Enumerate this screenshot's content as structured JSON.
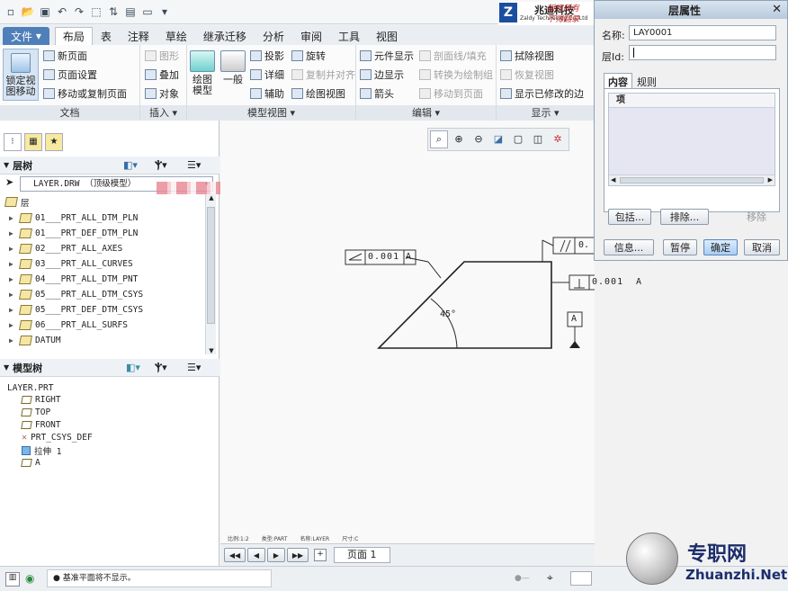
{
  "window": {
    "brand_name": "兆迪科技",
    "brand_sub": "Zaldy Technology Co.,Ltd",
    "notice1": "版权所有",
    "notice2": "不得翻录"
  },
  "tabs": [
    "文件",
    "布局",
    "表",
    "注释",
    "草绘",
    "继承迁移",
    "分析",
    "审阅",
    "工具",
    "视图"
  ],
  "ribbon": {
    "doc": {
      "lock_l1": "锁定视",
      "lock_l2": "图移动",
      "new_page": "新页面",
      "page_setup": "页面设置",
      "move_copy": "移动或复制页面",
      "label": "文档"
    },
    "insert": {
      "graphic": "图形",
      "overlay": "叠加",
      "object": "对象",
      "label": "插入"
    },
    "model_view": {
      "drawing_model_l1": "绘图",
      "drawing_model_l2": "模型",
      "general": "一般",
      "projection": "投影",
      "detail": "详细",
      "auxiliary": "辅助",
      "rotate": "旋转",
      "copy_align": "复制并对齐",
      "drawing_view": "绘图视图",
      "label": "模型视图"
    },
    "edit": {
      "element_display": "元件显示",
      "edge_display": "边显示",
      "arrow": "箭头",
      "section_line": "剖面线/填充",
      "convert_group": "转换为绘制组",
      "move_to_page": "移动到页面",
      "label": "编辑"
    },
    "display": {
      "erase_view": "拭除视图",
      "restore_view": "恢复视图",
      "show_modified": "显示已修改的边",
      "label": "显示"
    }
  },
  "layer_tree": {
    "title": "层树",
    "model_selector": "LAYER.DRW （顶级模型）",
    "root": "层",
    "items": [
      "01___PRT_ALL_DTM_PLN",
      "01___PRT_DEF_DTM_PLN",
      "02___PRT_ALL_AXES",
      "03___PRT_ALL_CURVES",
      "04___PRT_ALL_DTM_PNT",
      "05___PRT_ALL_DTM_CSYS",
      "05___PRT_DEF_DTM_CSYS",
      "06___PRT_ALL_SURFS",
      "DATUM"
    ]
  },
  "model_tree": {
    "title": "模型树",
    "root": "LAYER.PRT",
    "items": [
      "RIGHT",
      "TOP",
      "FRONT",
      "PRT_CSYS_DEF",
      "拉伸 1",
      "A"
    ]
  },
  "drawing": {
    "angularity_value": "0.001",
    "angularity_datum": "A",
    "parallel_value": "0.",
    "perp_value": "0.001",
    "perp_datum": "A",
    "angle_label": "45°",
    "datum_tag": "A",
    "footer_scale": "比例:1:2",
    "footer_type": "类型:PART",
    "footer_name": "名称:LAYER",
    "footer_size": "尺寸:C"
  },
  "page_nav": {
    "page_label": "页面 1"
  },
  "dialog": {
    "title": "层属性",
    "name_label": "名称:",
    "name_value": "LAY0001",
    "layer_id_label": "层Id:",
    "layer_id_value": "",
    "tab_content": "内容",
    "tab_rules": "规则",
    "column_item": "项",
    "include_btn": "包括...",
    "exclude_btn": "排除...",
    "remove_btn": "移除",
    "info_btn": "信息...",
    "pause_btn": "暂停",
    "ok_btn": "确定",
    "cancel_btn": "取消"
  },
  "status": {
    "message": "● 基准平面将不显示。"
  },
  "watermark": {
    "cn": "专职网",
    "url": "Zhuanzhi.Net"
  }
}
